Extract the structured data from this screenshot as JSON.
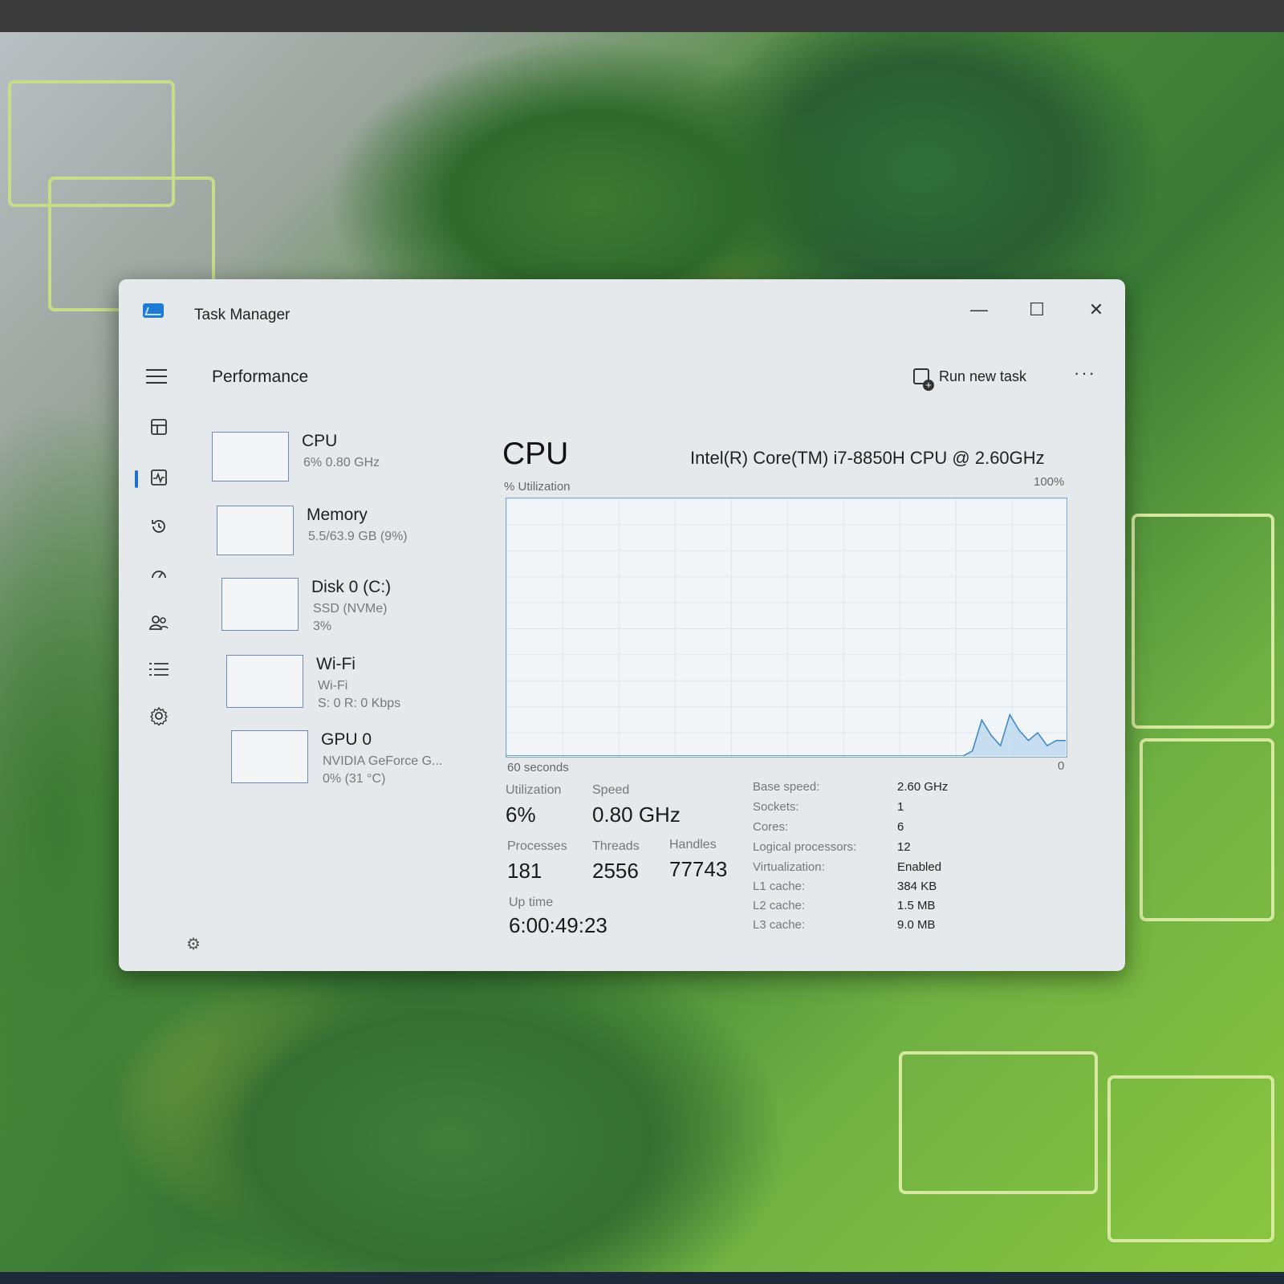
{
  "window": {
    "title": "Task Manager",
    "minimize": "—",
    "maximize": "☐",
    "close": "✕"
  },
  "header": {
    "section": "Performance",
    "run_new_task": "Run new task",
    "more": "···"
  },
  "resources": [
    {
      "name": "CPU",
      "sub1": "6%  0.80 GHz",
      "sub2": "",
      "sub3": ""
    },
    {
      "name": "Memory",
      "sub1": "5.5/63.9 GB (9%)",
      "sub2": "",
      "sub3": ""
    },
    {
      "name": "Disk 0 (C:)",
      "sub1": "SSD (NVMe)",
      "sub2": "3%",
      "sub3": ""
    },
    {
      "name": "Wi-Fi",
      "sub1": "Wi-Fi",
      "sub2": "S: 0  R: 0 Kbps",
      "sub3": ""
    },
    {
      "name": "GPU 0",
      "sub1": "NVIDIA GeForce G...",
      "sub2": "0%  (31 °C)",
      "sub3": ""
    }
  ],
  "main": {
    "title": "CPU",
    "model": "Intel(R) Core(TM) i7-8850H CPU @ 2.60GHz",
    "util_label": "% Utilization",
    "max_label": "100%",
    "time_label": "60 seconds",
    "zero_label": "0"
  },
  "stats": {
    "utilization_label": "Utilization",
    "utilization": "6%",
    "speed_label": "Speed",
    "speed": "0.80 GHz",
    "processes_label": "Processes",
    "processes": "181",
    "threads_label": "Threads",
    "threads": "2556",
    "handles_label": "Handles",
    "handles": "77743",
    "uptime_label": "Up time",
    "uptime": "6:00:49:23"
  },
  "specs": [
    {
      "key": "Base speed:",
      "value": "2.60 GHz"
    },
    {
      "key": "Sockets:",
      "value": "1"
    },
    {
      "key": "Cores:",
      "value": "6"
    },
    {
      "key": "Logical processors:",
      "value": "12"
    },
    {
      "key": "Virtualization:",
      "value": "Enabled"
    },
    {
      "key": "L1 cache:",
      "value": "384 KB"
    },
    {
      "key": "L2 cache:",
      "value": "1.5 MB"
    },
    {
      "key": "L3 cache:",
      "value": "9.0 MB"
    }
  ],
  "chart_data": {
    "type": "area",
    "title": "",
    "ylabel": "% Utilization",
    "ylim": [
      0,
      100
    ],
    "xlim": [
      60,
      0
    ],
    "x": [
      60,
      11,
      10,
      9,
      8,
      7,
      6,
      5,
      4,
      3,
      2,
      1,
      0
    ],
    "series": [
      {
        "name": "",
        "values": [
          0,
          0,
          2,
          14,
          8,
          4,
          16,
          10,
          6,
          9,
          4,
          6,
          6
        ]
      }
    ]
  },
  "colors": {
    "accent": "#1f6fd1",
    "graph_border": "#7aa6cf",
    "graph_fill": "#bcd7ee",
    "graph_line": "#3b86c8"
  },
  "icons": {
    "nav": [
      "processes-icon",
      "performance-icon",
      "app-history-icon",
      "startup-apps-icon",
      "users-icon",
      "details-icon",
      "services-icon"
    ],
    "settings": "settings-icon"
  }
}
